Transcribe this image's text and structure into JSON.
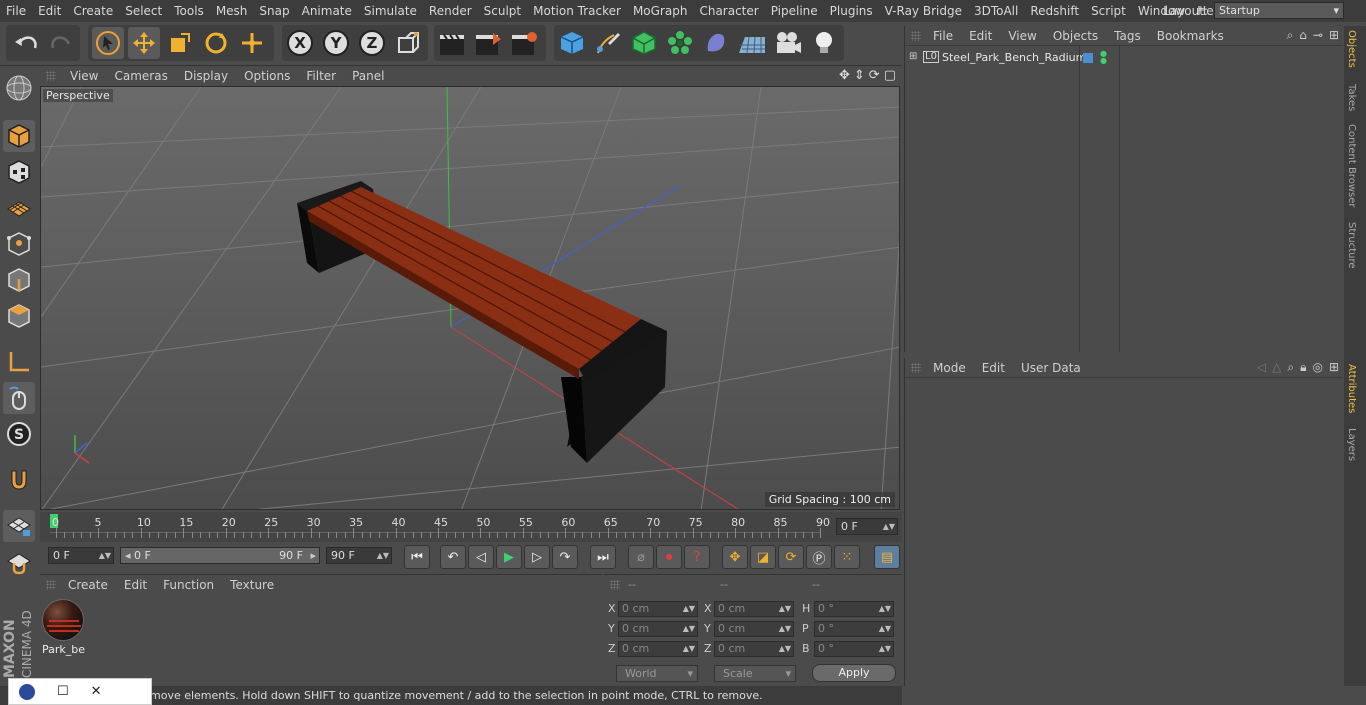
{
  "menubar": {
    "items": [
      "File",
      "Edit",
      "Create",
      "Select",
      "Tools",
      "Mesh",
      "Snap",
      "Animate",
      "Simulate",
      "Render",
      "Sculpt",
      "Motion Tracker",
      "MoGraph",
      "Character",
      "Pipeline",
      "Plugins",
      "V-Ray Bridge",
      "3DToAll",
      "Redshift",
      "Script",
      "Window",
      "Help"
    ],
    "layout_label": "Layout:",
    "layout_value": "Startup"
  },
  "viewport": {
    "menu": [
      "View",
      "Cameras",
      "Display",
      "Options",
      "Filter",
      "Panel"
    ],
    "camera_label": "Perspective",
    "grid_spacing": "Grid Spacing : 100 cm"
  },
  "timeline": {
    "ticks": [
      "0",
      "5",
      "10",
      "15",
      "20",
      "25",
      "30",
      "35",
      "40",
      "45",
      "50",
      "55",
      "60",
      "65",
      "70",
      "75",
      "80",
      "85",
      "90"
    ],
    "current_frame": "0 F"
  },
  "controls": {
    "start_frame": "0 F",
    "range_start": "0 F",
    "range_end": "90 F",
    "end_frame": "90 F"
  },
  "material_panel": {
    "menu": [
      "Create",
      "Edit",
      "Function",
      "Texture"
    ],
    "material_name": "Park_be"
  },
  "coord_panel": {
    "headers": [
      "--",
      "--",
      "--"
    ],
    "rows": [
      {
        "l1": "X",
        "v1": "0 cm",
        "l2": "X",
        "v2": "0 cm",
        "l3": "H",
        "v3": "0 °"
      },
      {
        "l1": "Y",
        "v1": "0 cm",
        "l2": "Y",
        "v2": "0 cm",
        "l3": "P",
        "v3": "0 °"
      },
      {
        "l1": "Z",
        "v1": "0 cm",
        "l2": "Z",
        "v2": "0 cm",
        "l3": "B",
        "v3": "0 °"
      }
    ],
    "world": "World",
    "scale": "Scale",
    "apply": "Apply"
  },
  "object_panel": {
    "menu": [
      "File",
      "Edit",
      "View",
      "Objects",
      "Tags",
      "Bookmarks"
    ],
    "object_name": "Steel_Park_Bench_Radium"
  },
  "attr_panel": {
    "menu": [
      "Mode",
      "Edit",
      "User Data"
    ]
  },
  "side_tabs": [
    "Objects",
    "Takes",
    "Content Browser",
    "Structure"
  ],
  "side_tabs2": [
    "Attributes",
    "Layers"
  ],
  "statusbar": {
    "text": "move elements. Hold down SHIFT to quantize movement / add to the selection in point mode, CTRL to remove."
  },
  "brand": {
    "maxon": "MAXON",
    "product": "CINEMA 4D"
  },
  "colors": {
    "accent": "#f0c040",
    "axis_x": "#d04040",
    "axis_y": "#40c040",
    "axis_z": "#4060e0",
    "wood": "#8a2e14"
  }
}
